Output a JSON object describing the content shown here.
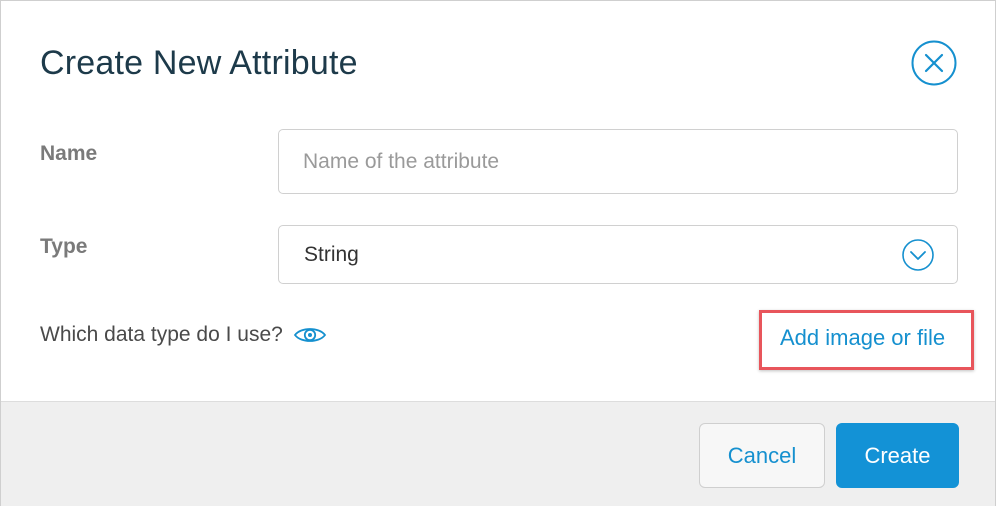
{
  "dialog": {
    "title": "Create New Attribute",
    "close_icon": "close-circle-icon"
  },
  "form": {
    "name": {
      "label": "Name",
      "placeholder": "Name of the attribute",
      "value": ""
    },
    "type": {
      "label": "Type",
      "value": "String",
      "chevron_icon": "chevron-down-circle-icon"
    },
    "help_text": "Which data type do I use?",
    "help_icon": "eye-icon",
    "add_link": "Add image or file"
  },
  "footer": {
    "cancel_label": "Cancel",
    "create_label": "Create"
  },
  "colors": {
    "accent": "#1590cf",
    "primary_button": "#1392d6",
    "highlight": "#e8555b",
    "title": "#1d3a4a",
    "footer_bg": "#efefef"
  }
}
